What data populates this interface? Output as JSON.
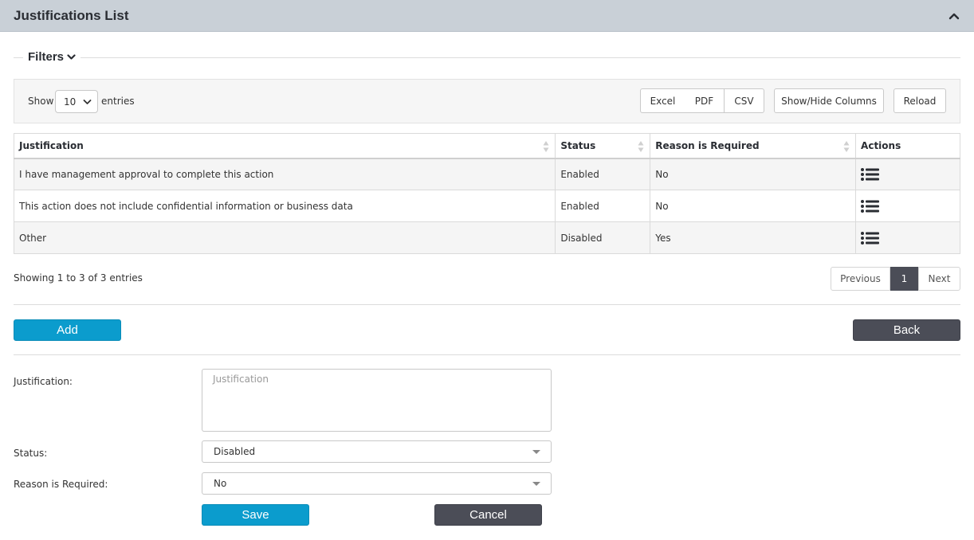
{
  "header": {
    "title": "Justifications List",
    "collapse_icon": "chevron-up-icon"
  },
  "filters": {
    "label": "Filters",
    "icon": "chevron-down-icon"
  },
  "toolbar": {
    "show_label": "Show",
    "entries_value": "10",
    "entries_label": "entries",
    "excel": "Excel",
    "pdf": "PDF",
    "csv": "CSV",
    "show_hide": "Show/Hide Columns",
    "reload": "Reload"
  },
  "table": {
    "columns": [
      "Justification",
      "Status",
      "Reason is Required",
      "Actions"
    ],
    "rows": [
      {
        "justification": "I have management approval to complete this action",
        "status": "Enabled",
        "reason": "No"
      },
      {
        "justification": "This action does not include confidential information or business data",
        "status": "Enabled",
        "reason": "No"
      },
      {
        "justification": "Other",
        "status": "Disabled",
        "reason": "Yes"
      }
    ],
    "action_icon": "list-icon"
  },
  "pagination": {
    "info": "Showing 1 to 3 of 3 entries",
    "previous": "Previous",
    "page": "1",
    "next": "Next"
  },
  "actions": {
    "add": "Add",
    "back": "Back"
  },
  "form": {
    "justification_label": "Justification:",
    "justification_placeholder": "Justification",
    "status_label": "Status:",
    "status_value": "Disabled",
    "reason_label": "Reason is Required:",
    "reason_value": "No",
    "save": "Save",
    "cancel": "Cancel"
  },
  "colors": {
    "enabled": "#3c9a55",
    "primary": "#0b9ccd",
    "dark": "#4b4d57",
    "header_bg": "#c9d0d7"
  }
}
